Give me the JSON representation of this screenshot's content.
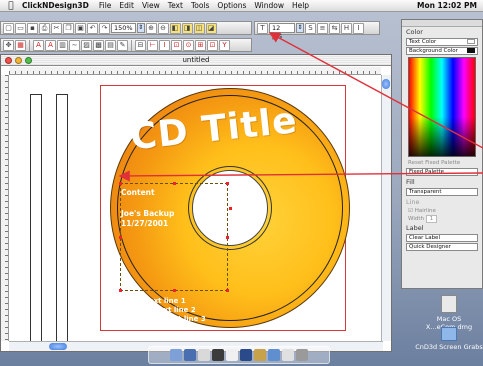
{
  "menubar": {
    "apple": "",
    "app_name": "ClickNDesign3D",
    "menus": [
      "File",
      "Edit",
      "View",
      "Text",
      "Tools",
      "Options",
      "Window",
      "Help"
    ],
    "clock": "Mon 12:02 PM"
  },
  "toolbar_top": {
    "zoom": "150%",
    "font_size": "12 pts"
  },
  "document": {
    "title": "untitled",
    "cd_title": "CD Title",
    "content_label": "Content",
    "content_lines": [
      "Joe's Backup",
      "11/27/2001"
    ],
    "sub_lines": [
      "Sub text line 1",
      "Sub text line 2",
      "Sub text line 3"
    ]
  },
  "palette": {
    "color_section": "Color",
    "text_color": "Text Color",
    "background_color": "Background Color",
    "reset_fixed": "Reset Fixed Palette",
    "fixed_palette": "Fixed Palette",
    "fill_section": "Fill",
    "fill_value": "Transparent",
    "line_section": "Line",
    "hairline": "Hairline",
    "width_label": "Width",
    "width_value": "1",
    "label_section": "Label",
    "clear_label": "Clear Label",
    "quick_designer": "Quick Designer"
  },
  "desktop_icons": [
    "Mac OS X...eCom.dmg",
    "CnD3d Screen Grabs"
  ],
  "colors": {
    "accent": "#3d79d8",
    "selection": "#d23a3a",
    "disc_outer": "#e56b12",
    "disc_inner": "#ffd23a"
  }
}
